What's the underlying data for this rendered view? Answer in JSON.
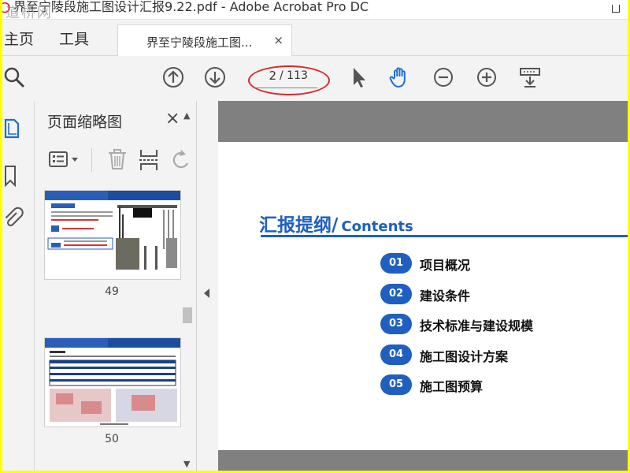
{
  "window": {
    "title": "界至宁陵段施工图设计汇报9.22.pdf - Adobe Acrobat Pro DC",
    "watermark": "道桥网"
  },
  "tabs": {
    "home": "主页",
    "tools": "工具",
    "document": "界至宁陵段施工图...",
    "close": "×"
  },
  "toolbar": {
    "icons": [
      "search-icon",
      "prev-page-icon",
      "next-page-icon",
      "select-arrow-icon",
      "hand-icon",
      "zoom-out-icon",
      "zoom-in-icon",
      "marquee-zoom-icon"
    ],
    "page_current": "2",
    "page_total": "/ 113"
  },
  "rail": {
    "icons": [
      "page-thumbnails-icon",
      "bookmark-icon",
      "attachment-icon"
    ],
    "accent": "#1f6fd1"
  },
  "panel": {
    "title": "页面缩略图",
    "close": "×",
    "tool_icons": [
      "thumbnail-options-icon",
      "delete-page-icon",
      "insert-page-icon",
      "undo-icon"
    ],
    "thumbnails": [
      {
        "page": "49"
      },
      {
        "page": "50"
      }
    ]
  },
  "document": {
    "title_cn": "汇报提纲/",
    "title_en": "Contents",
    "accent": "#1f5fbf",
    "items": [
      {
        "num": "01",
        "text": "项目概况"
      },
      {
        "num": "02",
        "text": "建设条件"
      },
      {
        "num": "03",
        "text": "技术标准与建设规模"
      },
      {
        "num": "04",
        "text": "施工图设计方案"
      },
      {
        "num": "05",
        "text": "施工图预算"
      }
    ]
  },
  "annotation": {
    "ellipse_color": "#d9262b"
  }
}
